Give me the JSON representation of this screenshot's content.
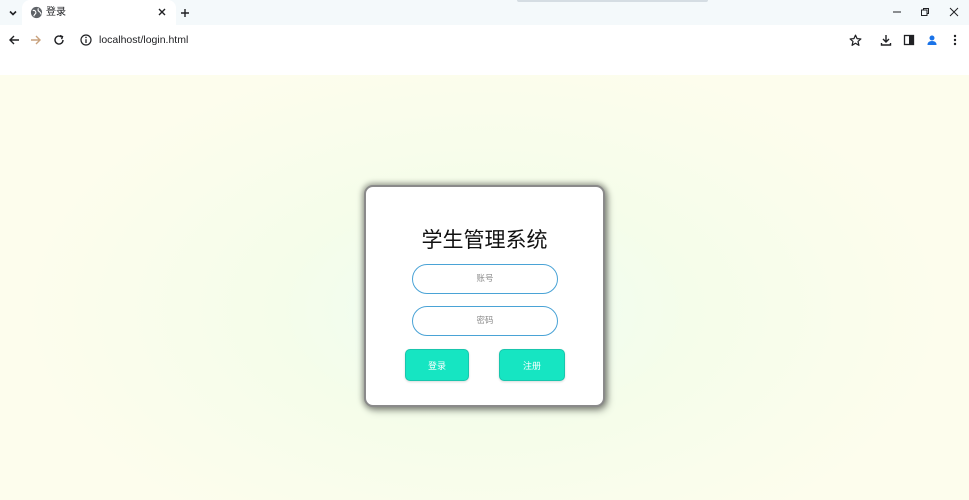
{
  "browser": {
    "tab": {
      "title": "登录",
      "favicon": "globe-icon"
    },
    "address_bar": {
      "url": "localhost/login.html",
      "security_icon": "info-icon"
    },
    "toolbar_icons": [
      "back-arrow-icon",
      "forward-arrow-icon",
      "reload-icon",
      "star-icon",
      "download-icon",
      "side-panel-icon",
      "profile-icon",
      "menu-icon"
    ],
    "window_controls": [
      "minimize-icon",
      "restore-icon",
      "close-icon"
    ]
  },
  "page": {
    "title": "学生管理系统",
    "form": {
      "username_placeholder": "账号",
      "password_placeholder": "密码",
      "login_label": "登录",
      "register_label": "注册"
    }
  },
  "colors": {
    "button_fill": "#16e5c2",
    "input_border": "#4aa3d6",
    "profile_icon": "#1a73e8",
    "page_background": "#fdfded"
  }
}
